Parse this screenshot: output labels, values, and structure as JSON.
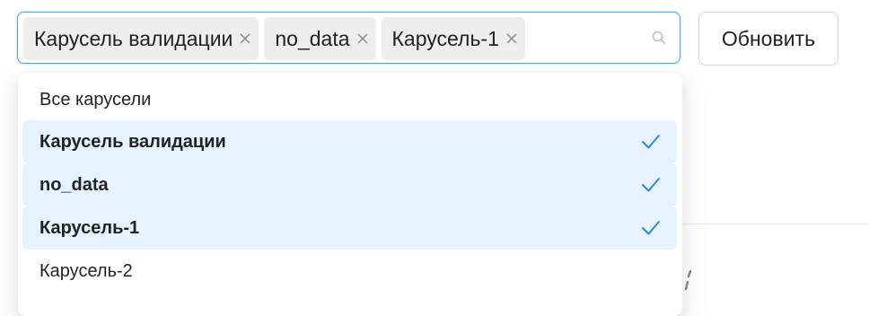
{
  "select": {
    "tags": [
      {
        "label": "Карусель валидации"
      },
      {
        "label": "no_data"
      },
      {
        "label": "Карусель-1"
      }
    ]
  },
  "refresh_button": {
    "label": "Обновить"
  },
  "dropdown": {
    "options": [
      {
        "label": "Все карусели",
        "selected": false
      },
      {
        "label": "Карусель валидации",
        "selected": true
      },
      {
        "label": "no_data",
        "selected": true
      },
      {
        "label": "Карусель-1",
        "selected": true
      },
      {
        "label": "Карусель-2",
        "selected": false
      }
    ]
  },
  "colors": {
    "focus_border": "#4fa8de",
    "selected_bg": "#e6f3fd",
    "check": "#2f86d8",
    "tag_bg": "#eeeeee"
  }
}
